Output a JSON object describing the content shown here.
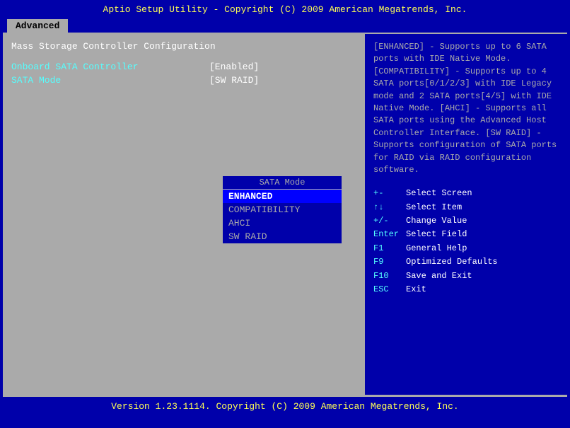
{
  "title_bar": {
    "text": "Aptio Setup Utility - Copyright (C) 2009 American Megatrends, Inc."
  },
  "tabs": [
    {
      "label": "Advanced",
      "active": true
    }
  ],
  "left_panel": {
    "section_title": "Mass Storage Controller Configuration",
    "rows": [
      {
        "label": "Onboard SATA Controller",
        "value": "[Enabled]"
      },
      {
        "label": "SATA Mode",
        "value": "[SW RAID]"
      }
    ]
  },
  "dropdown": {
    "title": "SATA Mode",
    "items": [
      {
        "label": "ENHANCED",
        "selected": true
      },
      {
        "label": "COMPATIBILITY",
        "selected": false
      },
      {
        "label": "AHCI",
        "selected": false
      },
      {
        "label": "SW RAID",
        "selected": false
      }
    ]
  },
  "right_panel": {
    "help_text": "[ENHANCED] - Supports up to 6 SATA ports with IDE Native Mode.\n[COMPATIBILITY] - Supports up to 4 SATA ports[0/1/2/3] with IDE Legacy mode and 2 SATA ports[4/5] with IDE Native Mode.\n[AHCI] - Supports all SATA ports using the Advanced Host Controller Interface.\n[SW RAID] - Supports configuration of SATA ports for RAID via RAID configuration software.",
    "keys": [
      {
        "key": "+-",
        "desc": "Select Screen"
      },
      {
        "key": "↑↓",
        "desc": "Select Item"
      },
      {
        "key": "+/-",
        "desc": "Change Value"
      },
      {
        "key": "Enter",
        "desc": "Select Field"
      },
      {
        "key": "F1",
        "desc": "General Help"
      },
      {
        "key": "F9",
        "desc": "Optimized Defaults"
      },
      {
        "key": "F10",
        "desc": "Save and Exit"
      },
      {
        "key": "ESC",
        "desc": "Exit"
      }
    ]
  },
  "footer": {
    "text": "Version 1.23.1114. Copyright (C) 2009 American Megatrends, Inc."
  }
}
